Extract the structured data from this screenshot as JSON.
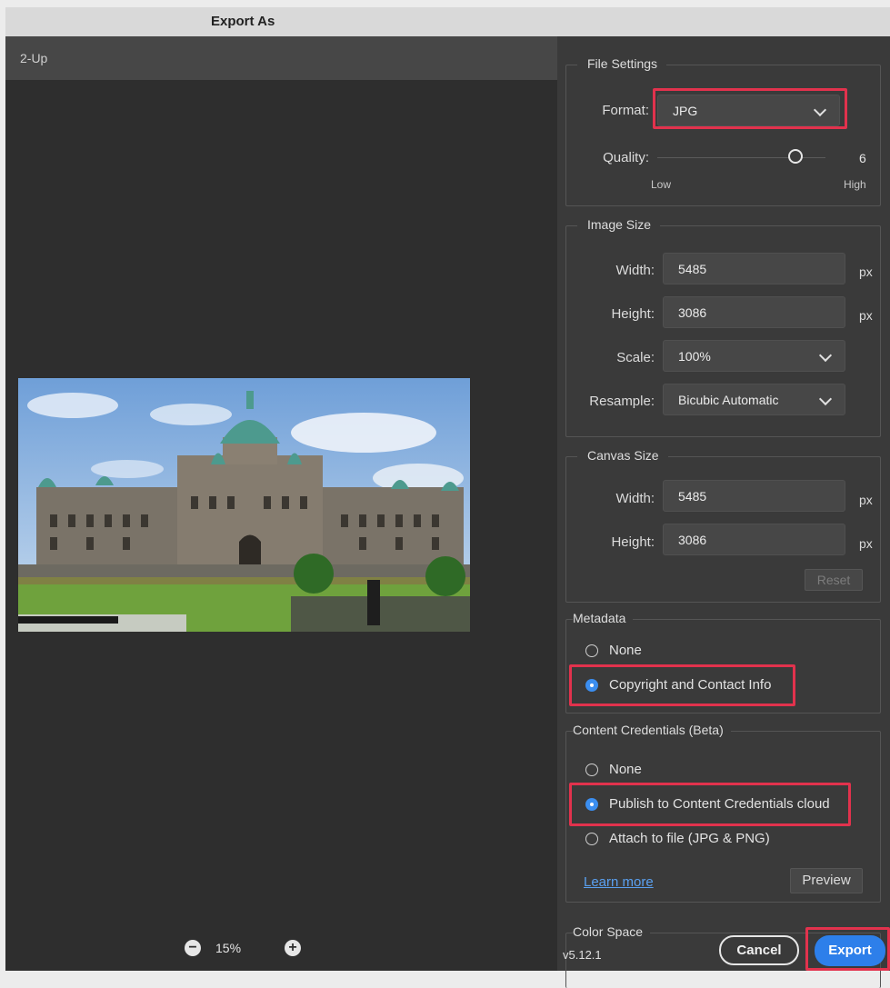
{
  "window": {
    "title": "Export As"
  },
  "preview": {
    "mode_label": "2-Up",
    "zoom": "15%",
    "zoom_out_icon": "minus",
    "zoom_in_icon": "plus"
  },
  "file_settings": {
    "title": "File Settings",
    "format_label": "Format:",
    "format_value": "JPG",
    "quality_label": "Quality:",
    "quality_value": "6",
    "quality_fraction": 0.82,
    "quality_low": "Low",
    "quality_high": "High"
  },
  "image_size": {
    "title": "Image Size",
    "width_label": "Width:",
    "width_value": "5485",
    "width_unit": "px",
    "height_label": "Height:",
    "height_value": "3086",
    "height_unit": "px",
    "scale_label": "Scale:",
    "scale_value": "100%",
    "resample_label": "Resample:",
    "resample_value": "Bicubic Automatic"
  },
  "canvas_size": {
    "title": "Canvas Size",
    "width_label": "Width:",
    "width_value": "5485",
    "width_unit": "px",
    "height_label": "Height:",
    "height_value": "3086",
    "height_unit": "px",
    "reset_label": "Reset"
  },
  "metadata": {
    "title": "Metadata",
    "options": [
      {
        "label": "None",
        "selected": false
      },
      {
        "label": "Copyright and Contact Info",
        "selected": true
      }
    ]
  },
  "content_credentials": {
    "title": "Content Credentials (Beta)",
    "options": [
      {
        "label": "None",
        "selected": false
      },
      {
        "label": "Publish to Content Credentials cloud",
        "selected": true
      },
      {
        "label": "Attach to file (JPG & PNG)",
        "selected": false
      }
    ],
    "learn_more": "Learn more",
    "preview_label": "Preview"
  },
  "color_space": {
    "title": "Color Space"
  },
  "footer": {
    "version": "v5.12.1",
    "cancel_label": "Cancel",
    "export_label": "Export"
  },
  "colors": {
    "accent": "#3b8ef0",
    "highlight": "#e2324d",
    "panel_bg": "#3a3a3a",
    "preview_bg": "#2e2e2e"
  }
}
